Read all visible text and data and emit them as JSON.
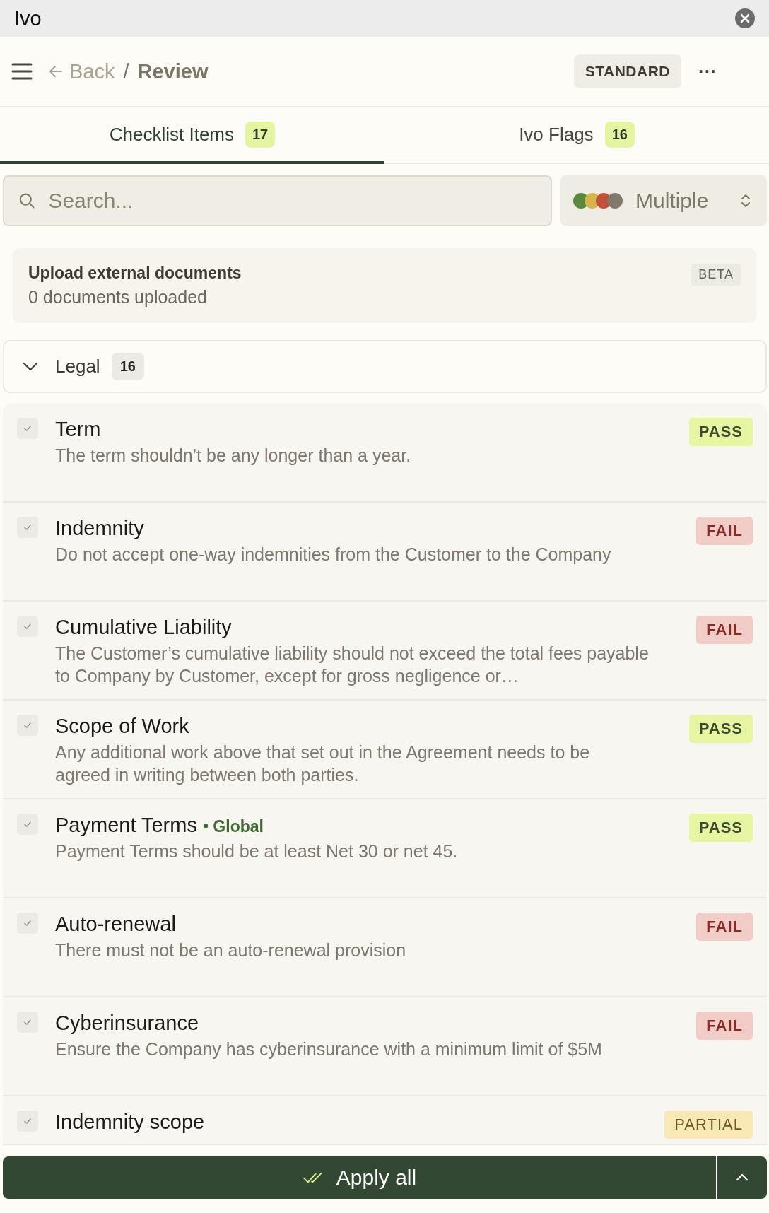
{
  "window": {
    "title": "Ivo"
  },
  "header": {
    "back": "Back",
    "separator": "/",
    "page": "Review",
    "mode_badge": "STANDARD",
    "more": "···"
  },
  "tabs": [
    {
      "label": "Checklist Items",
      "count": "17",
      "selected": true
    },
    {
      "label": "Ivo Flags",
      "count": "16",
      "selected": false
    }
  ],
  "search": {
    "placeholder": "Search..."
  },
  "filter": {
    "label": "Multiple",
    "dots": [
      {
        "color": "#5a8a3c"
      },
      {
        "color": "#d6b44a"
      },
      {
        "color": "#c2503a"
      },
      {
        "color": "#807a6c"
      }
    ]
  },
  "upload": {
    "title": "Upload external documents",
    "subtitle": "0 documents uploaded",
    "badge": "BETA"
  },
  "group": {
    "label": "Legal",
    "count": "16",
    "expanded": true
  },
  "items": [
    {
      "title": "Term",
      "description": "The term shouldn’t be any longer than a year.",
      "kind": "pass",
      "status": "PASS",
      "checked": true
    },
    {
      "title": "Indemnity",
      "description": "Do not accept one-way indemnities from the Customer to the Company",
      "kind": "fail",
      "status": "FAIL",
      "checked": true
    },
    {
      "title": "Cumulative Liability",
      "description": "The Customer’s cumulative liability should not exceed the total fees payable to Company by Customer, except for gross negligence or…",
      "kind": "fail",
      "status": "FAIL",
      "checked": true
    },
    {
      "title": "Scope of Work",
      "description": "Any additional work above that set out in the Agreement needs to be agreed in writing between both parties.",
      "kind": "pass",
      "status": "PASS",
      "checked": true
    },
    {
      "title": "Payment Terms",
      "tag": "• Global",
      "description": "Payment Terms should be at least Net 30 or net 45.",
      "kind": "pass",
      "status": "PASS",
      "checked": true
    },
    {
      "title": "Auto-renewal",
      "description": "There must not be an auto-renewal provision",
      "kind": "fail",
      "status": "FAIL",
      "checked": true
    },
    {
      "title": "Cyberinsurance",
      "description": "Ensure the Company has cyberinsurance with a minimum limit of $5M",
      "kind": "fail",
      "status": "FAIL",
      "checked": true
    },
    {
      "title": "Indemnity scope",
      "kind": "partial",
      "status": "PARTIAL",
      "checked": true
    }
  ],
  "footer": {
    "apply": "Apply all"
  }
}
